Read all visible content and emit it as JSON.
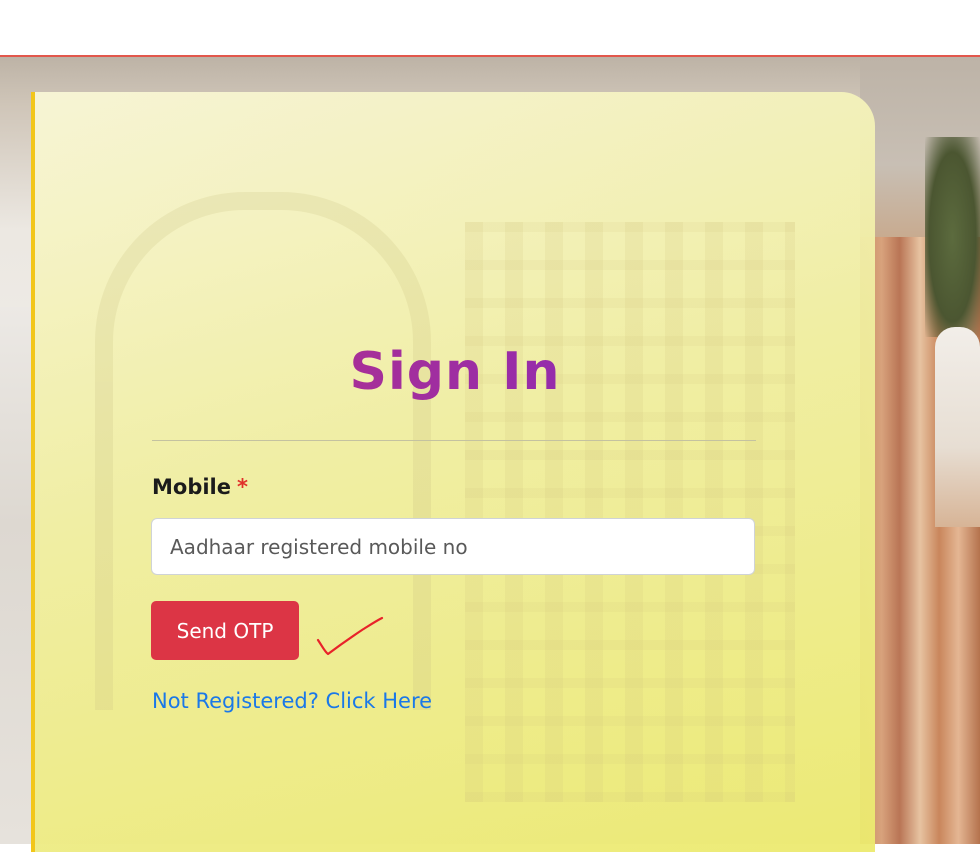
{
  "signin": {
    "title": "Sign In",
    "mobile_label": "Mobile",
    "required_marker": "*",
    "mobile_placeholder": "Aadhaar registered mobile no",
    "mobile_value": "",
    "send_otp_label": "Send OTP",
    "register_link": "Not Registered? Click Here"
  },
  "annotation": {
    "icon": "checkmark-icon",
    "color": "#e8232a"
  },
  "colors": {
    "accent_red": "#dc3545",
    "link_blue": "#1a78e8",
    "title_gradient_start": "#c2347a",
    "title_gradient_end": "#7a27c9",
    "card_border": "#f2c61a",
    "header_rule": "#e2574c"
  }
}
